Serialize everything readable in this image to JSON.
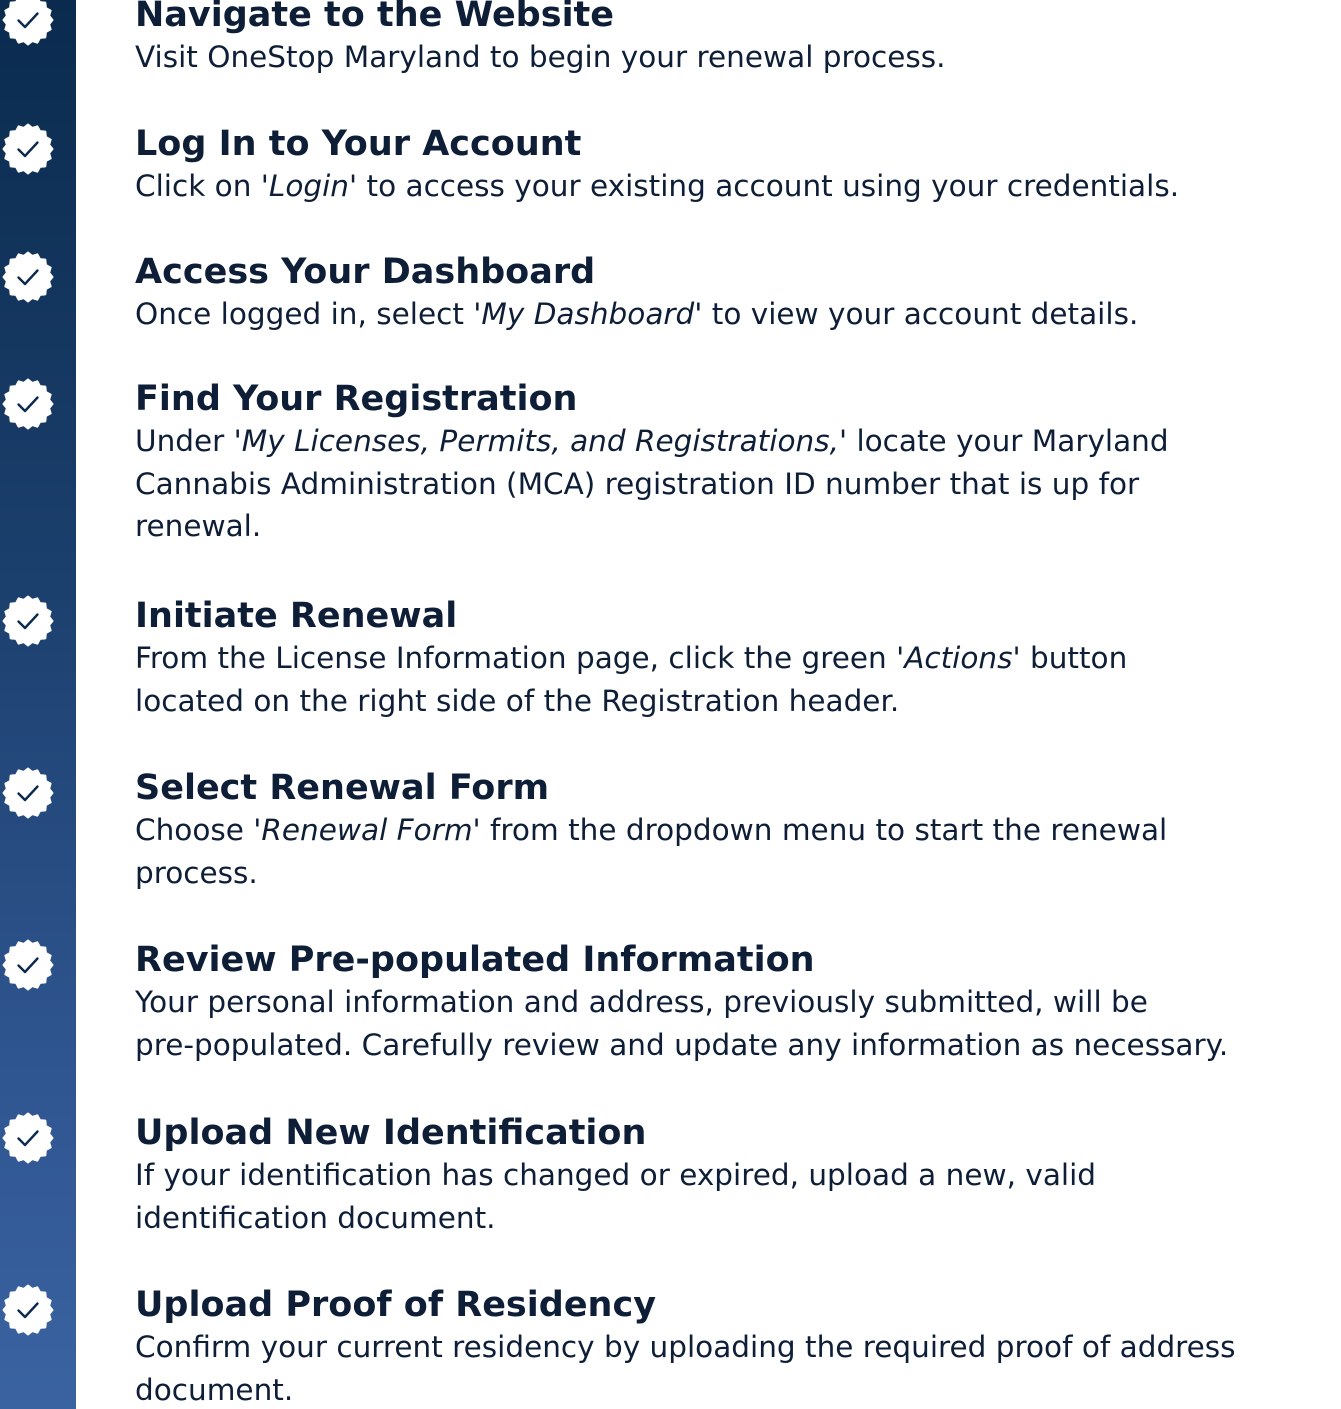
{
  "colors": {
    "rail_top": "#0a2b4e",
    "rail_bottom": "#3a63a1",
    "text": "#0e1e37",
    "badge": "#ffffff"
  },
  "steps": [
    {
      "icon": "check-badge-icon",
      "title": "Navigate to the Website",
      "desc": [
        {
          "pre": "Visit OneStop Maryland to begin your renewal process.",
          "em": "",
          "post": ""
        }
      ]
    },
    {
      "icon": "check-badge-icon",
      "title": "Log In to Your Account",
      "desc": [
        {
          "pre": "Click on '",
          "em": "Login'",
          "post": " to access your existing account using your credentials."
        }
      ]
    },
    {
      "icon": "check-badge-icon",
      "title": "Access Your Dashboard",
      "desc": [
        {
          "pre": "Once logged in, select ",
          "em": "'My Dashboard'",
          "post": " to view your account details."
        }
      ]
    },
    {
      "icon": "check-badge-icon",
      "title": "Find Your Registration",
      "desc": [
        {
          "pre": "Under ",
          "em": "'My Licenses, Permits, and Registrations,'",
          "post": " locate your Maryland"
        },
        {
          "pre": "Cannabis Administration (MCA) registration ID number that is up for",
          "em": "",
          "post": ""
        },
        {
          "pre": "renewal.",
          "em": "",
          "post": ""
        }
      ]
    },
    {
      "icon": "check-badge-icon",
      "title": "Initiate Renewal",
      "desc": [
        {
          "pre": "From the License Information page, click the green '",
          "em": "Actions'",
          "post": " button"
        },
        {
          "pre": "located on the right side of the Registration header.",
          "em": "",
          "post": ""
        }
      ]
    },
    {
      "icon": "check-badge-icon",
      "title": "Select Renewal Form",
      "desc": [
        {
          "pre": "Choose ",
          "em": "'Renewal Form'",
          "post": " from the dropdown menu to start the renewal"
        },
        {
          "pre": "process.",
          "em": "",
          "post": ""
        }
      ]
    },
    {
      "icon": "check-badge-icon",
      "title": "Review Pre-populated Information",
      "desc": [
        {
          "pre": "Your personal information and address, previously submitted, will be",
          "em": "",
          "post": ""
        },
        {
          "pre": "pre-populated. Carefully review and update any information as necessary.",
          "em": "",
          "post": ""
        }
      ]
    },
    {
      "icon": "check-badge-icon",
      "title": "Upload New Identification",
      "desc": [
        {
          "pre": "If your identification has changed or expired, upload a new, valid",
          "em": "",
          "post": ""
        },
        {
          "pre": "identification document.",
          "em": "",
          "post": ""
        }
      ]
    },
    {
      "icon": "check-badge-icon",
      "title": "Upload Proof of Residency",
      "desc": [
        {
          "pre": "Confirm your current residency by uploading the required proof of address",
          "em": "",
          "post": ""
        },
        {
          "pre": "document.",
          "em": "",
          "post": ""
        }
      ]
    }
  ]
}
